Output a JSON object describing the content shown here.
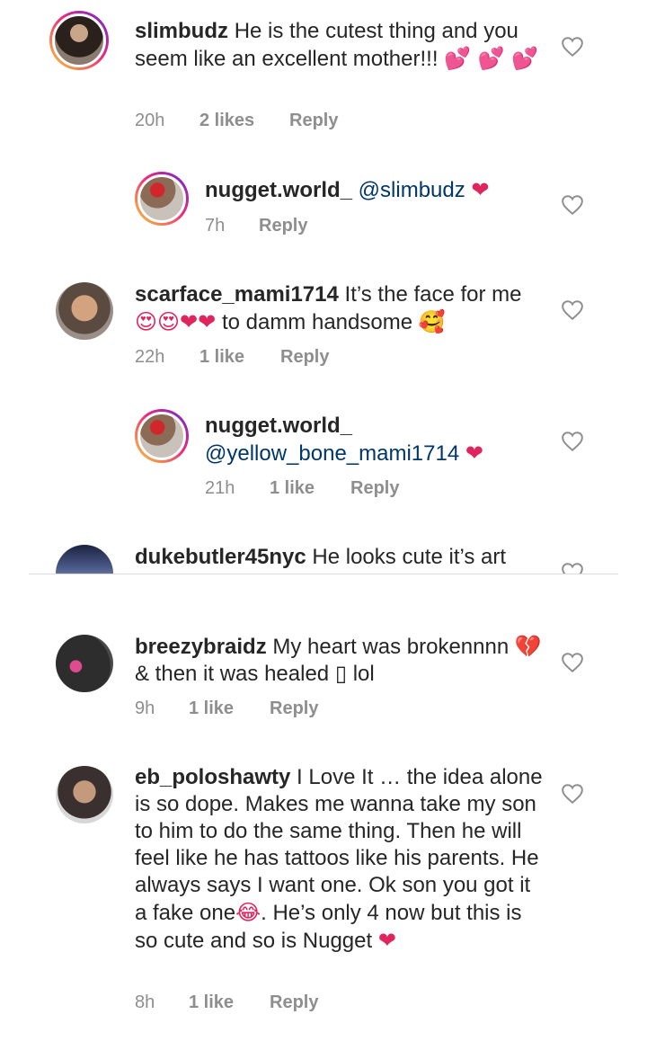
{
  "comments": [
    {
      "username": "slimbudz",
      "text": "He is the cutest thing and you seem like an excellent mother!!!",
      "emojis": "💕 💕 💕",
      "time": "20h",
      "likes": "2 likes",
      "reply": "Reply"
    },
    {
      "username": "nugget.world_",
      "mention": "@slimbudz",
      "emojis": "❤",
      "time": "7h",
      "reply": "Reply"
    },
    {
      "username": "scarface_mami1714",
      "text_part1": "It’s the face for me",
      "emojis_mid": "😍😍❤❤",
      "text_part2": "to damm handsome",
      "emoji_end": "🥰",
      "time": "22h",
      "likes": "1 like",
      "reply": "Reply"
    },
    {
      "username": "nugget.world_",
      "mention": "@yellow_bone_mami1714",
      "emojis": "❤",
      "time": "21h",
      "likes": "1 like",
      "reply": "Reply"
    },
    {
      "username": "dukebutler45nyc",
      "text": "He looks cute it’s art"
    },
    {
      "username": "breezybraidz",
      "text_part1": "My heart was brokennnn",
      "emoji_broken": "💔",
      "text_part2": "& then it was healed",
      "missing_glyph": "▯",
      "text_part3": "lol",
      "time": "9h",
      "likes": "1 like",
      "reply": "Reply"
    },
    {
      "username": "eb_poloshawty",
      "text": "I Love It … the idea alone is so dope. Makes me wanna take my son to him to do the same thing. Then he will feel like he has tattoos like his parents. He always says I want one. Ok son you got it a fake one",
      "emoji_laugh": "😂",
      "text_part2": ". He’s only 4 now but this is so cute and so is Nugget",
      "emoji_heart": "❤",
      "time": "8h",
      "likes": "1 like",
      "reply": "Reply"
    }
  ],
  "colors": {
    "username": "#262626",
    "meta": "#8e8e8e",
    "mention": "#00376b",
    "heart_emoji": "#e0245e"
  },
  "icons": [
    "heart-outline-icon"
  ]
}
